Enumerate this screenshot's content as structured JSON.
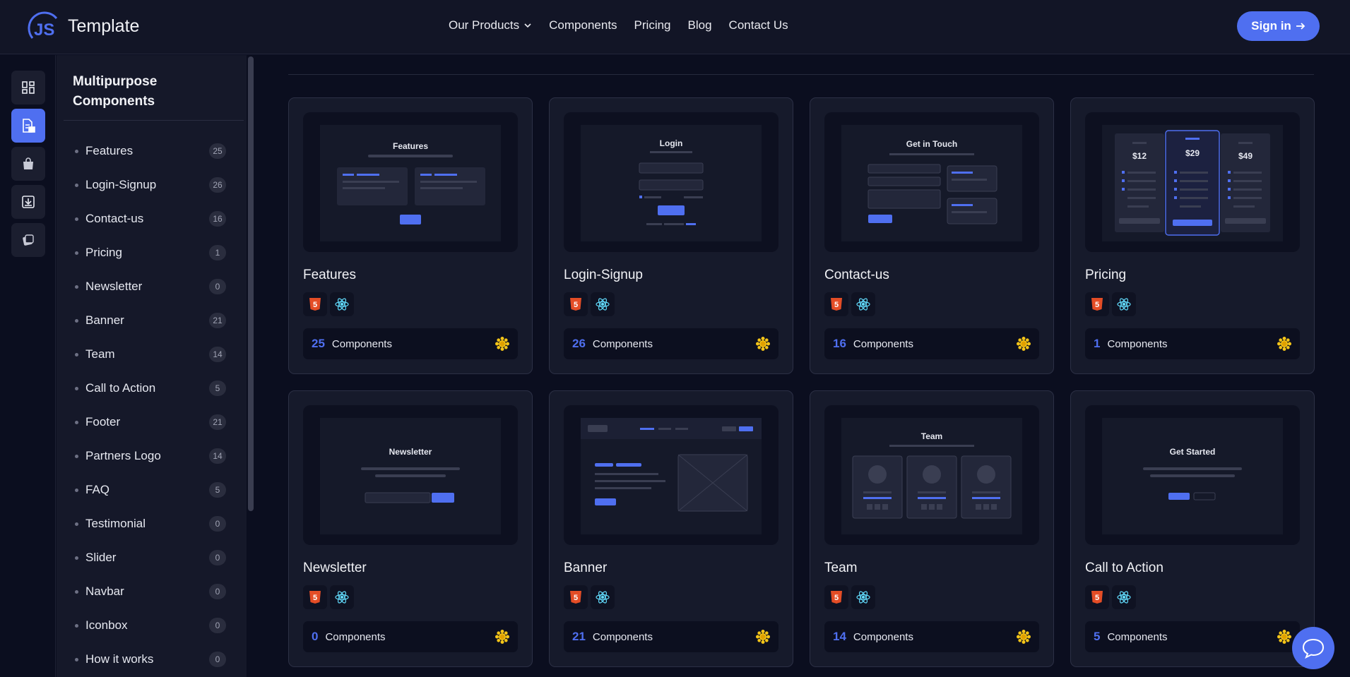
{
  "brand": {
    "logo_mark": "JS",
    "name": "Template"
  },
  "nav": {
    "items": [
      {
        "label": "Our Products",
        "has_dropdown": true
      },
      {
        "label": "Components"
      },
      {
        "label": "Pricing"
      },
      {
        "label": "Blog"
      },
      {
        "label": "Contact Us"
      }
    ],
    "signin_label": "Sign in"
  },
  "rail": {
    "icons": [
      "dashboard-icon",
      "components-icon",
      "shopping-bag-icon",
      "download-icon",
      "templates-icon"
    ],
    "active_index": 1
  },
  "sidebar": {
    "title": "Multipurpose Components",
    "items": [
      {
        "label": "Features",
        "count": "25"
      },
      {
        "label": "Login-Signup",
        "count": "26"
      },
      {
        "label": "Contact-us",
        "count": "16"
      },
      {
        "label": "Pricing",
        "count": "1"
      },
      {
        "label": "Newsletter",
        "count": "0"
      },
      {
        "label": "Banner",
        "count": "21"
      },
      {
        "label": "Team",
        "count": "14"
      },
      {
        "label": "Call to Action",
        "count": "5"
      },
      {
        "label": "Footer",
        "count": "21"
      },
      {
        "label": "Partners Logo",
        "count": "14"
      },
      {
        "label": "FAQ",
        "count": "5"
      },
      {
        "label": "Testimonial",
        "count": "0"
      },
      {
        "label": "Slider",
        "count": "0"
      },
      {
        "label": "Navbar",
        "count": "0"
      },
      {
        "label": "Iconbox",
        "count": "0"
      },
      {
        "label": "How it works",
        "count": "0"
      }
    ]
  },
  "cards": [
    {
      "title": "Features",
      "count": "25",
      "label": "Components",
      "preview_heading": "Features"
    },
    {
      "title": "Login-Signup",
      "count": "26",
      "label": "Components",
      "preview_heading": "Login"
    },
    {
      "title": "Contact-us",
      "count": "16",
      "label": "Components",
      "preview_heading": "Get in Touch"
    },
    {
      "title": "Pricing",
      "count": "1",
      "label": "Components",
      "preview_prices": [
        "$12",
        "$29",
        "$49"
      ]
    },
    {
      "title": "Newsletter",
      "count": "0",
      "label": "Components",
      "preview_heading": "Newsletter"
    },
    {
      "title": "Banner",
      "count": "21",
      "label": "Components"
    },
    {
      "title": "Team",
      "count": "14",
      "label": "Components",
      "preview_heading": "Team"
    },
    {
      "title": "Call to Action",
      "count": "5",
      "label": "Components",
      "preview_heading": "Get Started"
    }
  ],
  "colors": {
    "accent": "#4f6ff0",
    "background": "#0b0e1f",
    "card": "#161a2b",
    "html5": "#e44d26",
    "react": "#61dafb"
  }
}
